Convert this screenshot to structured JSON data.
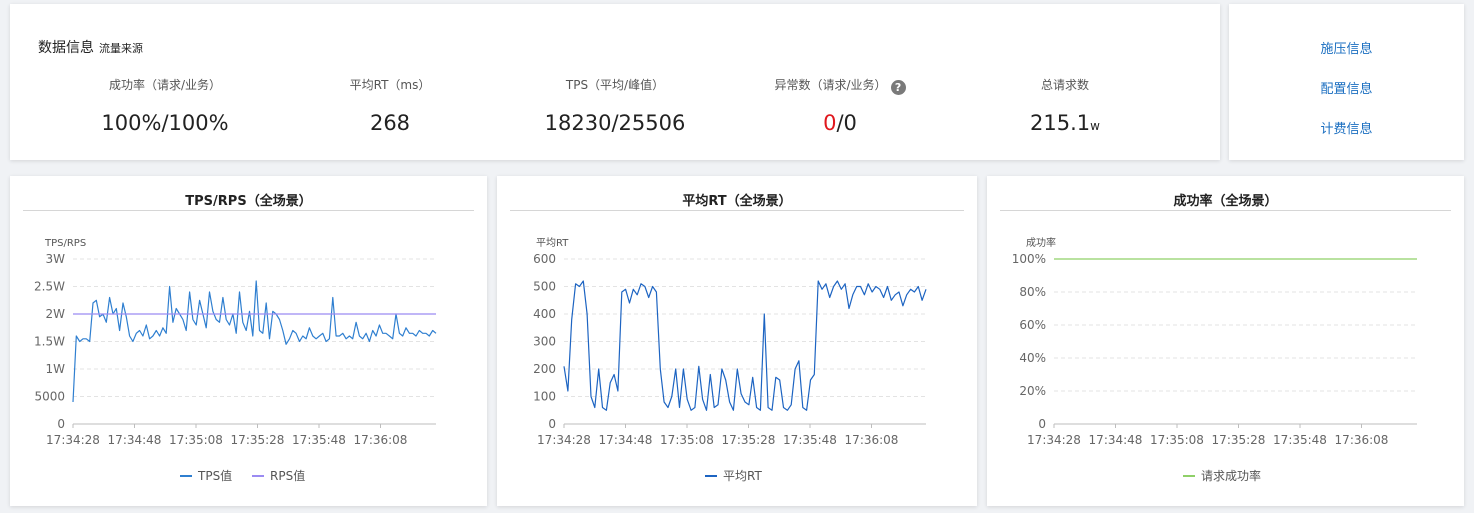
{
  "info": {
    "title": "数据信息",
    "subtitle": "流量来源",
    "metrics": [
      {
        "label": "成功率（请求/业务）",
        "value": "100%/100%"
      },
      {
        "label": "平均RT（ms）",
        "value": "268"
      },
      {
        "label": "TPS（平均/峰值）",
        "value": "18230/25506"
      },
      {
        "label": "异常数（请求/业务）",
        "value_red": "0",
        "value_rest": "/0",
        "help": "?"
      },
      {
        "label": "总请求数",
        "value": "215.1",
        "unit": "w"
      }
    ]
  },
  "links": [
    "施压信息",
    "配置信息",
    "计费信息"
  ],
  "colors": {
    "tps": "#2f7fd0",
    "rps": "#9b8bf2",
    "rt": "#1d64c2",
    "success": "#8fd068",
    "error": "#e0171d",
    "link": "#1a6ec0"
  },
  "chart_data": [
    {
      "type": "line",
      "title": "TPS/RPS（全场景）",
      "ylabel": "TPS/RPS",
      "ylim": [
        0,
        30000
      ],
      "yticks": [
        {
          "v": 0,
          "label": "0"
        },
        {
          "v": 5000,
          "label": "5000"
        },
        {
          "v": 10000,
          "label": "1W"
        },
        {
          "v": 15000,
          "label": "1.5W"
        },
        {
          "v": 20000,
          "label": "2W"
        },
        {
          "v": 25000,
          "label": "2.5W"
        },
        {
          "v": 30000,
          "label": "3W"
        }
      ],
      "xlabels": [
        "17:34:28",
        "17:34:48",
        "17:35:08",
        "17:35:28",
        "17:35:48",
        "17:36:08"
      ],
      "legend": [
        "TPS值",
        "RPS值"
      ],
      "series": [
        {
          "name": "TPS值",
          "values": [
            4000,
            16000,
            15000,
            15500,
            15500,
            15000,
            22000,
            22500,
            19500,
            20000,
            18500,
            23000,
            20000,
            21000,
            17000,
            22000,
            19500,
            16000,
            15000,
            16500,
            17000,
            16000,
            18000,
            15500,
            16000,
            17000,
            16000,
            17500,
            16500,
            25000,
            18500,
            21000,
            20000,
            19000,
            17000,
            24000,
            19000,
            18000,
            22500,
            20000,
            17500,
            24000,
            20500,
            19000,
            18500,
            23000,
            19000,
            18000,
            20000,
            16500,
            24000,
            18500,
            17000,
            20500,
            16000,
            26000,
            17000,
            16500,
            22000,
            15500,
            20500,
            20000,
            19000,
            17000,
            14500,
            15500,
            17000,
            16500,
            15000,
            16000,
            15500,
            17500,
            16000,
            15500,
            16000,
            16500,
            15000,
            15500,
            23000,
            16000,
            16000,
            16500,
            15500,
            16000,
            15500,
            18500,
            16000,
            15500,
            16500,
            15000,
            17000,
            16000,
            18000,
            16500,
            16500,
            16000,
            15500,
            20000,
            16500,
            16000,
            17500,
            16500,
            16500,
            16000,
            17000,
            16500,
            16500,
            16000,
            17000,
            16500
          ]
        },
        {
          "name": "RPS值",
          "values": [
            20000,
            20000
          ]
        }
      ]
    },
    {
      "type": "line",
      "title": "平均RT（全场景）",
      "ylabel": "平均RT",
      "ylim": [
        0,
        600
      ],
      "yticks": [
        {
          "v": 0,
          "label": "0"
        },
        {
          "v": 100,
          "label": "100"
        },
        {
          "v": 200,
          "label": "200"
        },
        {
          "v": 300,
          "label": "300"
        },
        {
          "v": 400,
          "label": "400"
        },
        {
          "v": 500,
          "label": "500"
        },
        {
          "v": 600,
          "label": "600"
        }
      ],
      "xlabels": [
        "17:34:28",
        "17:34:48",
        "17:35:08",
        "17:35:28",
        "17:35:48",
        "17:36:08"
      ],
      "legend": [
        "平均RT"
      ],
      "series": [
        {
          "name": "平均RT",
          "values": [
            210,
            120,
            380,
            510,
            500,
            520,
            400,
            100,
            60,
            200,
            60,
            50,
            150,
            180,
            120,
            480,
            490,
            440,
            490,
            470,
            510,
            500,
            460,
            500,
            480,
            200,
            80,
            60,
            100,
            200,
            60,
            200,
            90,
            50,
            60,
            210,
            90,
            50,
            180,
            60,
            70,
            200,
            160,
            80,
            50,
            200,
            110,
            80,
            70,
            170,
            60,
            50,
            400,
            60,
            50,
            170,
            160,
            60,
            50,
            70,
            200,
            230,
            60,
            50,
            160,
            180,
            520,
            490,
            510,
            460,
            500,
            520,
            490,
            510,
            420,
            470,
            500,
            500,
            470,
            510,
            480,
            500,
            490,
            460,
            500,
            450,
            470,
            480,
            430,
            470,
            490,
            480,
            500,
            450,
            490
          ]
        }
      ]
    },
    {
      "type": "line",
      "title": "成功率（全场景）",
      "ylabel": "成功率",
      "ylim": [
        0,
        100
      ],
      "yticks": [
        {
          "v": 0,
          "label": "0"
        },
        {
          "v": 20,
          "label": "20%"
        },
        {
          "v": 40,
          "label": "40%"
        },
        {
          "v": 60,
          "label": "60%"
        },
        {
          "v": 80,
          "label": "80%"
        },
        {
          "v": 100,
          "label": "100%"
        }
      ],
      "xlabels": [
        "17:34:28",
        "17:34:48",
        "17:35:08",
        "17:35:28",
        "17:35:48",
        "17:36:08"
      ],
      "legend": [
        "请求成功率"
      ],
      "series": [
        {
          "name": "请求成功率",
          "values": [
            100,
            100
          ]
        }
      ]
    }
  ]
}
